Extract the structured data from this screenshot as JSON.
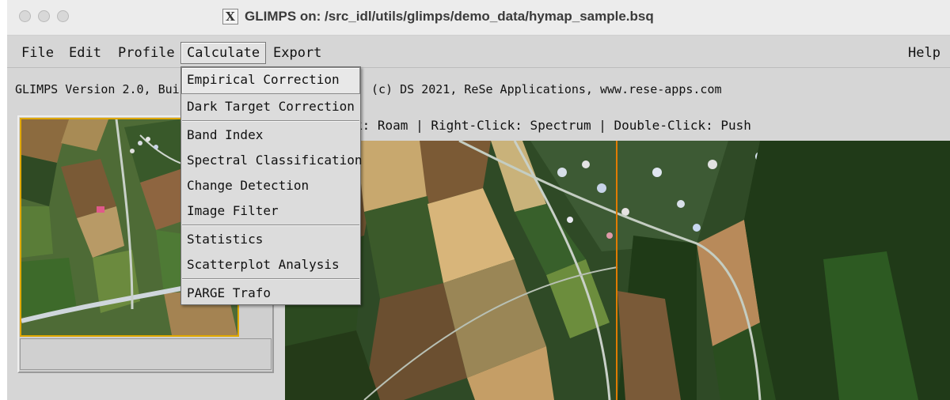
{
  "window": {
    "title": "GLIMPS on: /src_idl/utils/glimps/demo_data/hymap_sample.bsq",
    "x_logo": "X"
  },
  "menubar": {
    "file": "File",
    "edit": "Edit",
    "profile": "Profile",
    "calculate": "Calculate",
    "export": "Export",
    "help": "Help"
  },
  "info": {
    "version_text": "GLIMPS Version 2.0, Bui",
    "credits_text": "(c) DS 2021, ReSe Applications, www.rese-apps.com",
    "hint_text": "k: Roam | Right-Click: Spectrum | Double-Click: Push"
  },
  "calculate_menu": {
    "groups": [
      [
        "Empirical Correction",
        "Dark Target Correction"
      ],
      [
        "Band Index",
        "Spectral Classification",
        "Change Detection",
        "Image Filter"
      ],
      [
        "Statistics",
        "Scatterplot Analysis"
      ],
      [
        "PARGE Trafo"
      ]
    ]
  },
  "colors": {
    "window_bg": "#d6d6d6",
    "overview_border": "#e0a800",
    "crosshair": "#e07b00"
  },
  "icons": {
    "window_controls": [
      "close-button",
      "minimize-button",
      "zoom-button"
    ],
    "app_logo": "x11-icon"
  }
}
